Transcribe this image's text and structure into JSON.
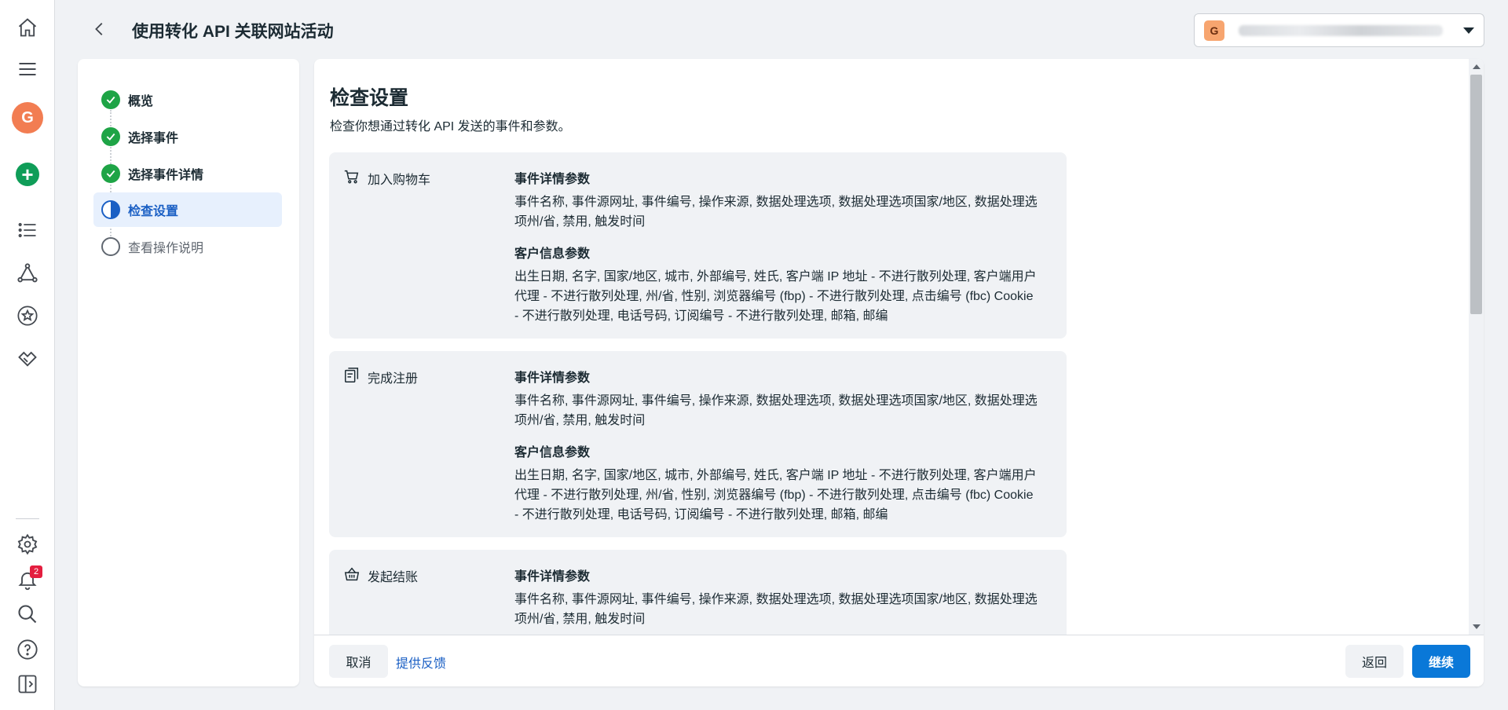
{
  "page_title": "使用转化 API 关联网站活动",
  "account": {
    "initial": "G"
  },
  "user": {
    "initial": "G"
  },
  "notifications": {
    "count": "2"
  },
  "steps": [
    {
      "label": "概览",
      "state": "done"
    },
    {
      "label": "选择事件",
      "state": "done"
    },
    {
      "label": "选择事件详情",
      "state": "done"
    },
    {
      "label": "检查设置",
      "state": "active"
    },
    {
      "label": "查看操作说明",
      "state": "todo"
    }
  ],
  "main": {
    "title": "检查设置",
    "description": "检查你想通过转化 API 发送的事件和参数。",
    "events": [
      {
        "name": "加入购物车",
        "icon": "cart-icon",
        "event_params_title": "事件详情参数",
        "event_params": "事件名称, 事件源网址, 事件编号, 操作来源, 数据处理选项, 数据处理选项国家/地区, 数据处理选项州/省, 禁用, 触发时间",
        "customer_params_title": "客户信息参数",
        "customer_params": "出生日期, 名字, 国家/地区, 城市, 外部编号, 姓氏, 客户端 IP 地址 - 不进行散列处理, 客户端用户代理 - 不进行散列处理, 州/省, 性别, 浏览器编号 (fbp) - 不进行散列处理, 点击编号 (fbc) Cookie - 不进行散列处理, 电话号码, 订阅编号 - 不进行散列处理, 邮箱, 邮编"
      },
      {
        "name": "完成注册",
        "icon": "registration-icon",
        "event_params_title": "事件详情参数",
        "event_params": "事件名称, 事件源网址, 事件编号, 操作来源, 数据处理选项, 数据处理选项国家/地区, 数据处理选项州/省, 禁用, 触发时间",
        "customer_params_title": "客户信息参数",
        "customer_params": "出生日期, 名字, 国家/地区, 城市, 外部编号, 姓氏, 客户端 IP 地址 - 不进行散列处理, 客户端用户代理 - 不进行散列处理, 州/省, 性别, 浏览器编号 (fbp) - 不进行散列处理, 点击编号 (fbc) Cookie - 不进行散列处理, 电话号码, 订阅编号 - 不进行散列处理, 邮箱, 邮编"
      },
      {
        "name": "发起结账",
        "icon": "basket-icon",
        "event_params_title": "事件详情参数",
        "event_params": "事件名称, 事件源网址, 事件编号, 操作来源, 数据处理选项, 数据处理选项国家/地区, 数据处理选项州/省, 禁用, 触发时间"
      }
    ]
  },
  "footer": {
    "cancel": "取消",
    "feedback": "提供反馈",
    "back": "返回",
    "continue": "继续"
  }
}
